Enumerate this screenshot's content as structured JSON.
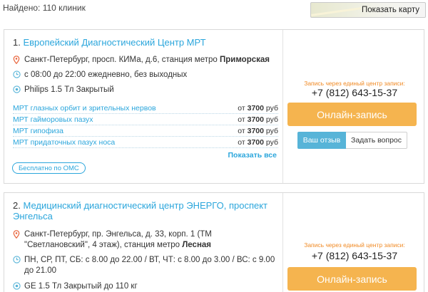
{
  "header": {
    "found_text": "Найдено: 110 клиник",
    "map_button": "Показать карту"
  },
  "clinics": [
    {
      "number": "1.",
      "name": "Европейский Диагностический Центр МРТ",
      "address_text": "Санкт-Петербург, просп. КИМа, д.6, станция метро ",
      "metro": "Приморская",
      "hours": "с 08:00 до 22:00 ежедневно, без выходных",
      "equipment": "Philips 1.5 Тл Закрытый",
      "services": [
        {
          "name": "МРТ глазных орбит и зрительных нервов",
          "price_prefix": "от ",
          "price": "3700",
          "currency": " руб"
        },
        {
          "name": "МРТ гайморовых пазух",
          "price_prefix": "от ",
          "price": "3700",
          "currency": " руб"
        },
        {
          "name": "МРТ гипофиза",
          "price_prefix": "от ",
          "price": "3700",
          "currency": " руб"
        },
        {
          "name": "МРТ придаточных пазух носа",
          "price_prefix": "от ",
          "price": "3700",
          "currency": " руб"
        }
      ],
      "show_all": "Показать все",
      "oms_badge": "Бесплатно по ОМС",
      "booking_note": "Запись через единый центр записи:",
      "phone": "+7 (812) 643-15-37",
      "book_button": "Онлайн-запись",
      "review_button": "Ваш отзыв",
      "ask_button": "Задать вопрос"
    },
    {
      "number": "2.",
      "name": "Медицинский диагностический центр ЭНЕРГО, проспект Энгельса",
      "address_text": "Санкт-Петербург, пр. Энгельса, д. 33, корп. 1 (ТМ \"Светлановский\", 4 этаж), станция метро ",
      "metro": "Лесная",
      "hours": "ПН, СР, ПТ, СБ: с 8.00 до 22.00 / ВТ, ЧТ: с 8.00 до 3.00 / ВС: с 9.00 до 21.00",
      "equipment": "GE 1.5 Тл Закрытый до 110 кг",
      "booking_note": "Запись через единый центр записи:",
      "phone": "+7 (812) 643-15-37",
      "book_button": "Онлайн-запись"
    }
  ],
  "colors": {
    "link": "#2ba6dc",
    "accent_orange": "#f5b44f",
    "note_orange": "#f08a24",
    "review_blue": "#57b4d8"
  },
  "icons": {
    "address": "map-pin-icon",
    "hours": "clock-icon",
    "equipment": "equipment-icon"
  }
}
